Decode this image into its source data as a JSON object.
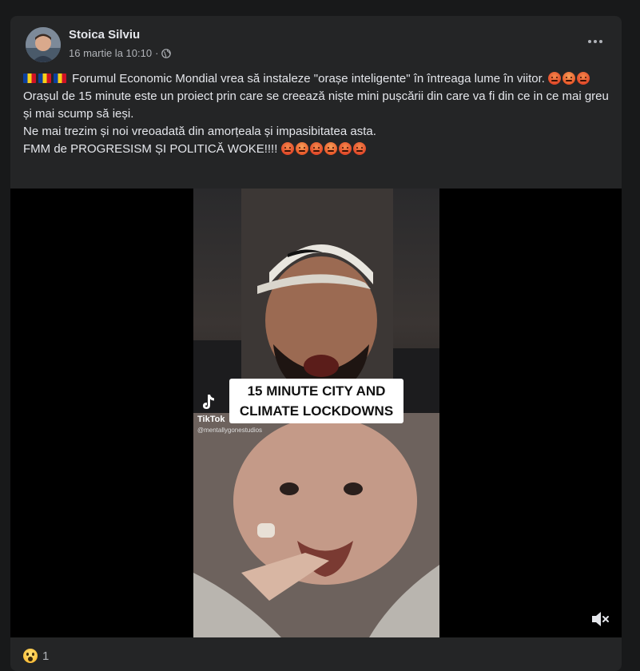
{
  "post": {
    "author": "Stoica Silviu",
    "timestamp": "16 martie la 10:10",
    "separator": "·",
    "privacy_icon": "globe-icon",
    "more_icon": "more-options-icon",
    "text": {
      "line1": "Forumul Economic Mondial vrea să instaleze \"orașe inteligente\" în întreaga lume în viitor.",
      "line2": "Orașul de 15 minute este un proiect prin care se creează niște mini pușcării din care va fi din ce in ce mai greu și mai scump să ieși.",
      "line3": "Ne mai trezim și noi vreoadată din amorțeala și impasibitatea asta.",
      "line4": "FMM de PROGRESISM ȘI POLITICĂ WOKE!!!!"
    },
    "emoji": {
      "flag": "romania-flag-icon",
      "angry": "angry-face-icon"
    }
  },
  "video": {
    "caption_line1": "15 MINUTE CITY AND",
    "caption_line2": "CLIMATE LOCKDOWNS",
    "watermark_brand": "TikTok",
    "watermark_user": "@mentallygonestudios",
    "mute_icon": "muted-speaker-icon"
  },
  "reactions": {
    "icon": "wow-reaction-icon",
    "count": "1"
  }
}
